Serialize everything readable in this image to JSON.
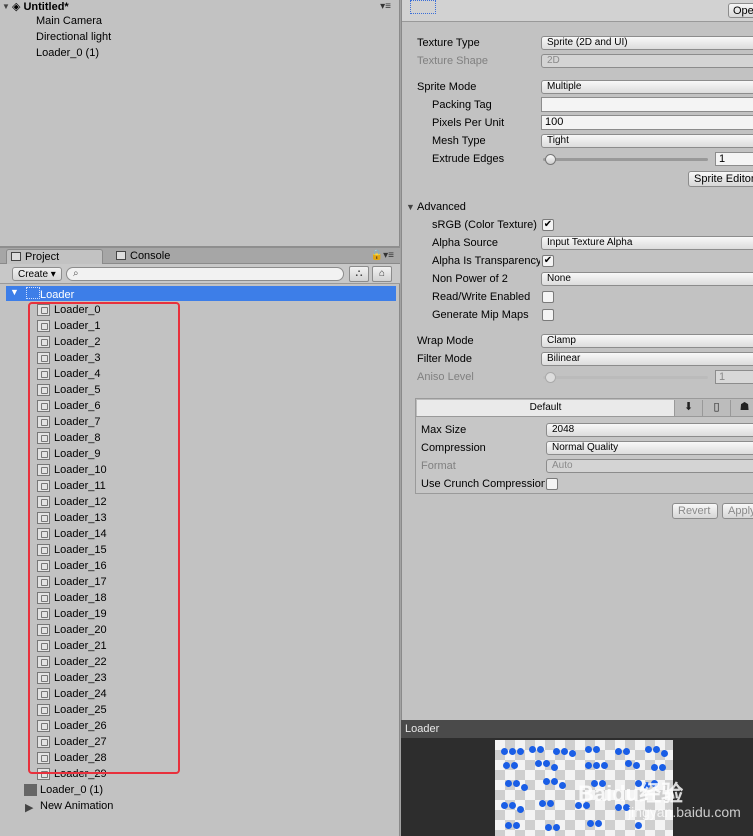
{
  "hierarchy": {
    "scene_name": "Untitled*",
    "items": [
      "Main Camera",
      "Directional light",
      "Loader_0 (1)"
    ]
  },
  "project": {
    "tabs": [
      "Project",
      "Console"
    ],
    "create_label": "Create",
    "selected_folder": "Loader",
    "sprites": [
      "Loader_0",
      "Loader_1",
      "Loader_2",
      "Loader_3",
      "Loader_4",
      "Loader_5",
      "Loader_6",
      "Loader_7",
      "Loader_8",
      "Loader_9",
      "Loader_10",
      "Loader_11",
      "Loader_12",
      "Loader_13",
      "Loader_14",
      "Loader_15",
      "Loader_16",
      "Loader_17",
      "Loader_18",
      "Loader_19",
      "Loader_20",
      "Loader_21",
      "Loader_22",
      "Loader_23",
      "Loader_24",
      "Loader_25",
      "Loader_26",
      "Loader_27",
      "Loader_28",
      "Loader_29"
    ],
    "other_assets": [
      "Loader_0 (1)",
      "New Animation"
    ]
  },
  "inspector": {
    "open_label": "Open",
    "texture_type": {
      "label": "Texture Type",
      "value": "Sprite (2D and UI)"
    },
    "texture_shape": {
      "label": "Texture Shape",
      "value": "2D"
    },
    "sprite_mode": {
      "label": "Sprite Mode",
      "value": "Multiple"
    },
    "packing_tag": {
      "label": "Packing Tag",
      "value": ""
    },
    "pixels_per_unit": {
      "label": "Pixels Per Unit",
      "value": "100"
    },
    "mesh_type": {
      "label": "Mesh Type",
      "value": "Tight"
    },
    "extrude_edges": {
      "label": "Extrude Edges",
      "value": "1"
    },
    "sprite_editor_label": "Sprite Editor",
    "advanced_label": "Advanced",
    "srgb": {
      "label": "sRGB (Color Texture)",
      "checked": true
    },
    "alpha_source": {
      "label": "Alpha Source",
      "value": "Input Texture Alpha"
    },
    "alpha_transparency": {
      "label": "Alpha Is Transparency",
      "checked": true
    },
    "non_power_of_2": {
      "label": "Non Power of 2",
      "value": "None"
    },
    "read_write": {
      "label": "Read/Write Enabled",
      "checked": false
    },
    "mip_maps": {
      "label": "Generate Mip Maps",
      "checked": false
    },
    "wrap_mode": {
      "label": "Wrap Mode",
      "value": "Clamp"
    },
    "filter_mode": {
      "label": "Filter Mode",
      "value": "Bilinear"
    },
    "aniso_level": {
      "label": "Aniso Level",
      "value": "1"
    },
    "platform_default_label": "Default",
    "max_size": {
      "label": "Max Size",
      "value": "2048"
    },
    "compression": {
      "label": "Compression",
      "value": "Normal Quality"
    },
    "format": {
      "label": "Format",
      "value": "Auto"
    },
    "crunch": {
      "label": "Use Crunch Compression",
      "checked": false
    },
    "revert_label": "Revert",
    "apply_label": "Apply"
  },
  "preview": {
    "title": "Loader",
    "watermark": "Baidu经验",
    "watermark_url": "jingyan.baidu.com"
  },
  "colors": {
    "selection": "#3d7ee8",
    "highlight_box": "#e8303c"
  }
}
